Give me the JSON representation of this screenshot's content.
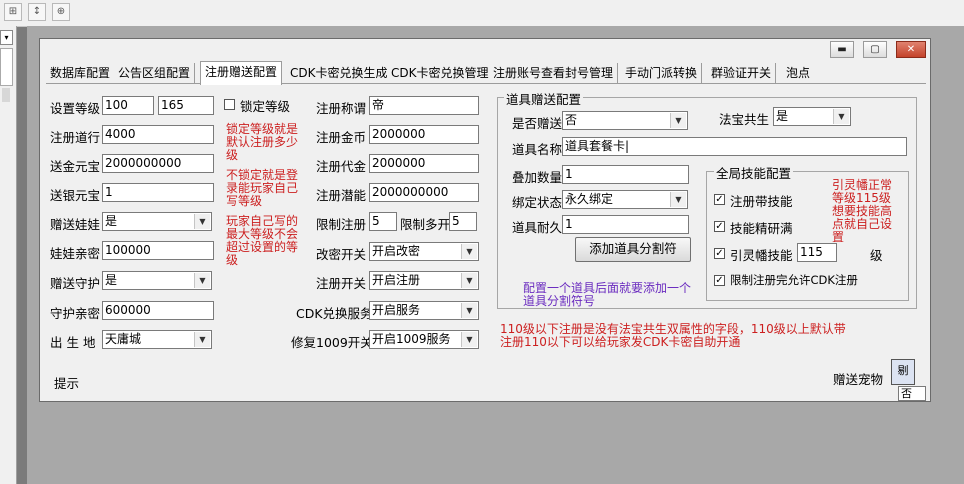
{
  "window": {
    "title": ""
  },
  "tabs": [
    {
      "label": "数据库配置"
    },
    {
      "label": "公告区组配置"
    },
    {
      "label": "注册赠送配置"
    },
    {
      "label": "CDK卡密兑换生成"
    },
    {
      "label": "CDK卡密兑换管理"
    },
    {
      "label": "注册账号查看封号管理"
    },
    {
      "label": "手动门派转换"
    },
    {
      "label": "群验证开关"
    },
    {
      "label": "泡点"
    }
  ],
  "col1": {
    "level_label": "设置等级",
    "level_min": "100",
    "level_max": "165",
    "reg_dao_label": "注册道行",
    "reg_dao": "4000",
    "gold_label": "送金元宝",
    "gold": "2000000000",
    "silver_label": "送银元宝",
    "silver": "1",
    "doll_label": "赠送娃娃",
    "doll": "是",
    "doll_intimacy_label": "娃娃亲密",
    "doll_intimacy": "100000",
    "guard_label": "赠送守护",
    "guard": "是",
    "guard_intimacy_label": "守护亲密",
    "guard_intimacy": "600000",
    "birthplace_label": "出 生 地",
    "birthplace": "天庸城"
  },
  "col2": {
    "lock_level_label": "锁定等级",
    "note1": "锁定等级就是默认注册多少级",
    "note2": "不锁定就是登录能玩家自己写等级",
    "note3": "玩家自己写的最大等级不会超过设置的等级"
  },
  "col3": {
    "title_label": "注册称谓",
    "title_value": "帝",
    "money_label": "注册金币",
    "money": "2000000",
    "voucher_label": "注册代金",
    "voucher": "2000000",
    "potential_label": "注册潜能",
    "potential": "2000000000",
    "limit_reg_label": "限制注册",
    "limit_reg": "5",
    "limit_multi_label": "限制多开",
    "limit_multi": "5",
    "pwd_switch_label": "改密开关",
    "pwd_switch": "开启改密",
    "reg_switch_label": "注册开关",
    "reg_switch": "开启注册",
    "cdk_label": "CDK兑换服务",
    "cdk_value": "开启服务",
    "repair_label": "修复1009开关",
    "repair_value": "开启1009服务"
  },
  "item_config": {
    "group_title": "道具赠送配置",
    "gift_label": "是否赠送",
    "gift": "否",
    "fabao_label": "法宝共生",
    "fabao": "是",
    "item_name_label": "道具名称",
    "item_name": "道具套餐卡|",
    "stack_label": "叠加数量",
    "stack": "1",
    "bind_label": "绑定状态",
    "bind": "永久绑定",
    "durability_label": "道具耐久",
    "durability": "1",
    "add_sep_button": "添加道具分割符",
    "purple_note": "配置一个道具后面就要添加一个道具分割符号"
  },
  "skills": {
    "group_title": "全局技能配置",
    "reg_skill_label": "注册带技能",
    "skill_master_label": "技能精研满",
    "yinling_label": "引灵幡技能",
    "yinling_value": "115",
    "yinling_unit": "级",
    "limit_cdk_label": "限制注册完允许CDK注册",
    "note": "引灵幡正常等级115级想要技能高点就自己设置"
  },
  "bottom_note": "110级以下注册是没有法宝共生双属性的字段，110级以上默认带注册110以下可以给玩家发CDK卡密自助开通",
  "hint_label": "提示",
  "pet_label": "赠送宠物（",
  "pet_value": "否",
  "pet_icon_text": "剔"
}
